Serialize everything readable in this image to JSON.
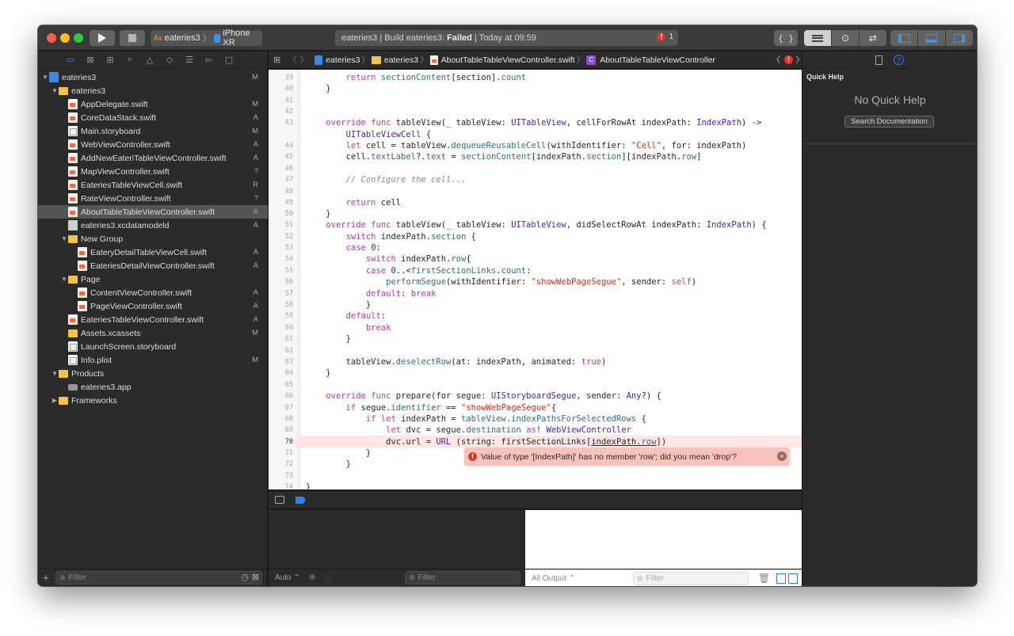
{
  "titlebar": {
    "scheme_project": "eateries3",
    "scheme_device": "iPhone XR",
    "activity_project": "eateries3",
    "activity_sep": "|",
    "activity_build": "Build eateries3:",
    "activity_status": "Failed",
    "activity_sep2": "|",
    "activity_time": "Today at 09:59",
    "error_count": "1",
    "braces_label": "{ }",
    "accent": "#2f7ff5",
    "error_color": "#e4352b"
  },
  "navigator": {
    "icons": [
      "folder-icon",
      "source-control-icon",
      "symbol-icon",
      "find-icon",
      "issue-icon",
      "test-icon",
      "debug-icon",
      "breakpoint-icon",
      "report-icon"
    ],
    "items": [
      {
        "label": "eateries3",
        "badge": "M",
        "kind": "project"
      },
      {
        "label": "eateries3",
        "badge": "",
        "kind": "folder"
      },
      {
        "label": "AppDelegate.swift",
        "badge": "M",
        "kind": "swift"
      },
      {
        "label": "CoreDataStack.swift",
        "badge": "A",
        "kind": "swift"
      },
      {
        "label": "Main.storyboard",
        "badge": "M",
        "kind": "sb"
      },
      {
        "label": "WebViewController.swift",
        "badge": "A",
        "kind": "swift"
      },
      {
        "label": "AddNewEateriTableViewController.swift",
        "badge": "A",
        "kind": "swift"
      },
      {
        "label": "MapViewController.swift",
        "badge": "?",
        "kind": "swift"
      },
      {
        "label": "EateriesTableViewCell.swift",
        "badge": "R",
        "kind": "swift"
      },
      {
        "label": "RateViewController.swift",
        "badge": "?",
        "kind": "swift"
      },
      {
        "label": "AboutTableTableViewController.swift",
        "badge": "A",
        "kind": "swift"
      },
      {
        "label": "eateries3.xcdatamodeld",
        "badge": "A",
        "kind": "model"
      },
      {
        "label": "New Group",
        "badge": "",
        "kind": "folder"
      },
      {
        "label": "EateryDetailTableViewCell.swift",
        "badge": "A",
        "kind": "swift"
      },
      {
        "label": "EateriesDetailViewController.swift",
        "badge": "A",
        "kind": "swift"
      },
      {
        "label": "Page",
        "badge": "",
        "kind": "folder"
      },
      {
        "label": "ContentViewController.swift",
        "badge": "A",
        "kind": "swift"
      },
      {
        "label": "PageViewController.swift",
        "badge": "A",
        "kind": "swift"
      },
      {
        "label": "EateriesTableViewController.swift",
        "badge": "A",
        "kind": "swift"
      },
      {
        "label": "Assets.xcassets",
        "badge": "M",
        "kind": "folder"
      },
      {
        "label": "LaunchScreen.storyboard",
        "badge": "",
        "kind": "sb"
      },
      {
        "label": "Info.plist",
        "badge": "M",
        "kind": "sb"
      },
      {
        "label": "Products",
        "badge": "",
        "kind": "folder"
      },
      {
        "label": "eateries3.app",
        "badge": "",
        "kind": "app"
      },
      {
        "label": "Frameworks",
        "badge": "",
        "kind": "folder"
      }
    ],
    "filter_placeholder": "Filter",
    "add_label": "+"
  },
  "jumpbar": {
    "crumbs": [
      "eateries3",
      "eateries3",
      "AboutTableTableViewController.swift",
      "AboutTableTableViewController"
    ],
    "class_badge": "C",
    "error_badge": "!"
  },
  "editor": {
    "line_numbers": [
      "39",
      "40",
      "41",
      "42",
      "43",
      "",
      "44",
      "45",
      "46",
      "47",
      "48",
      "49",
      "50",
      "51",
      "52",
      "53",
      "54",
      "55",
      "56",
      "57",
      "58",
      "59",
      "60",
      "61",
      "62",
      "63",
      "64",
      "65",
      "66",
      "67",
      "68",
      "69",
      "70",
      "71",
      "72",
      "73",
      "74"
    ],
    "error_message": "Value of type '[IndexPath]' has no member 'row'; did you mean 'drop'?",
    "error_icon": "!",
    "close_icon": "×"
  },
  "debug": {
    "auto_label": "Auto",
    "filter_placeholder": "Filter",
    "output_label": "All Output",
    "output_filter": "Filter"
  },
  "inspector": {
    "title": "Quick Help",
    "empty": "No Quick Help",
    "search_button": "Search Documentation"
  }
}
